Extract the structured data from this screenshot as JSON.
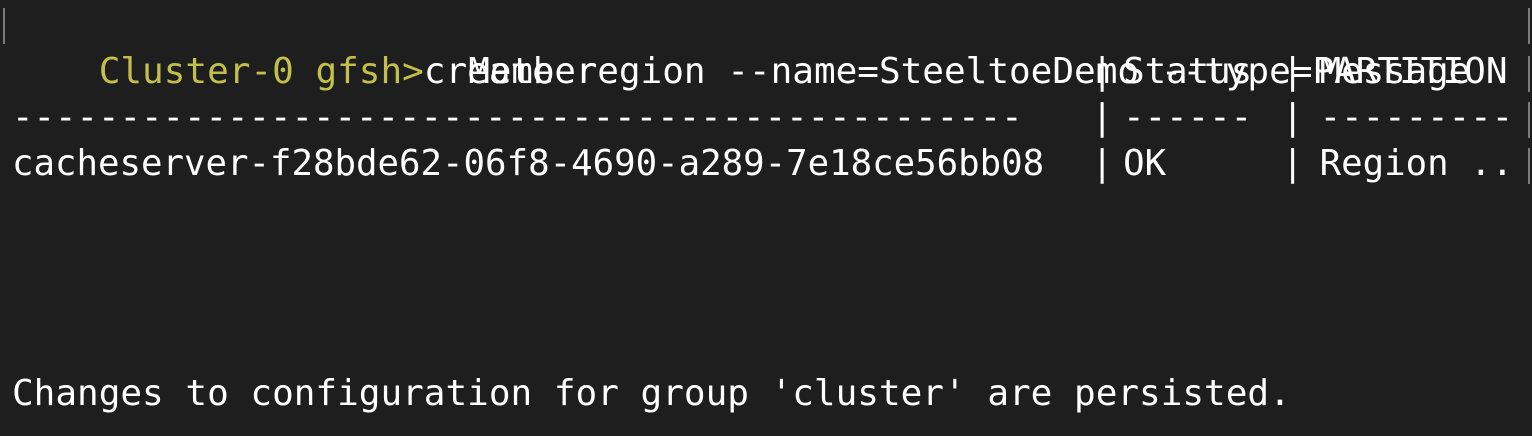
{
  "prompt": "Cluster-0 gfsh>",
  "command": "create region --name=SteeltoeDemo --type=PARTITION",
  "colors": {
    "background": "#1e1e1e",
    "prompt": "#c2bf4a",
    "text": "#ffffff"
  },
  "table": {
    "header": {
      "member": "Member",
      "sep1": "|",
      "status": "Status",
      "sep2": "|",
      "message": "Message"
    },
    "divider": {
      "member": "-----------------------------------------------",
      "sep1": "|",
      "status": "------",
      "sep2": "|",
      "message": "---------"
    },
    "rows": [
      {
        "member": "cacheserver-f28bde62-06f8-4690-a289-7e18ce56bb08",
        "sep1": "|",
        "status": "OK",
        "sep2": "|",
        "message": "Region .."
      }
    ]
  },
  "footer": "Changes to configuration for group 'cluster' are persisted."
}
